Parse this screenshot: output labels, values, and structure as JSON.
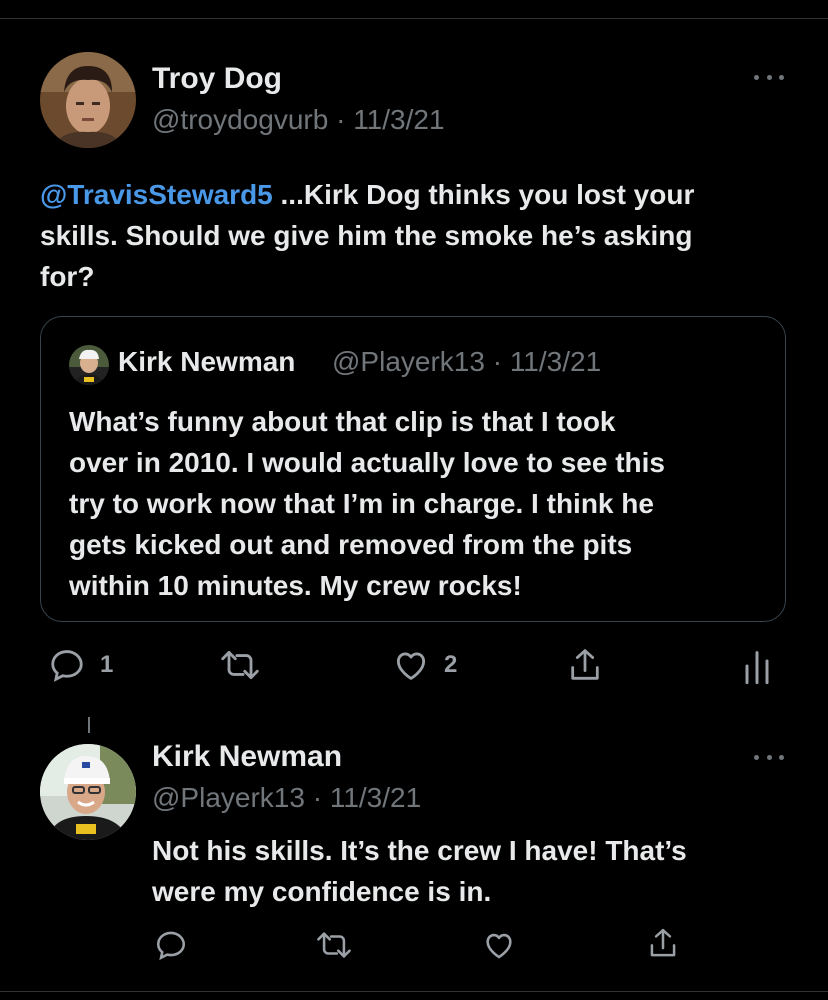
{
  "tweet": {
    "author_name": "Troy Dog",
    "handle": "@troydogvurb",
    "date": "11/3/21",
    "mention": "@TravisSteward5",
    "text_line1_rest": " ...Kirk Dog thinks you lost your",
    "text_line2": "skills. Should we give him the smoke he’s asking",
    "text_line3": "for?",
    "quoted": {
      "author_name": "Kirk Newman",
      "handle_date": "@Playerk13 · 11/3/21",
      "lines": [
        "What’s funny about that clip is that I took",
        "over in 2010. I would actually love to see this",
        "try to work now that I’m in charge. I think he",
        "gets kicked out and removed from the pits",
        "within 10 minutes. My crew rocks!"
      ]
    },
    "actions": {
      "reply_count": "1",
      "like_count": "2"
    }
  },
  "reply": {
    "author_name": "Kirk Newman",
    "handle": "@Playerk13",
    "date": "11/3/21",
    "lines": [
      "Not his skills. It’s the crew I have! That’s",
      "were my confidence is in."
    ]
  },
  "icons": {
    "more": "more-horizontal-icon",
    "reply": "reply-icon",
    "retweet": "retweet-icon",
    "like": "heart-icon",
    "share": "share-icon",
    "analytics": "analytics-icon"
  },
  "colors": {
    "background": "#000000",
    "text": "#e7e9ea",
    "secondary": "#71767b",
    "link": "#4a99e9"
  }
}
